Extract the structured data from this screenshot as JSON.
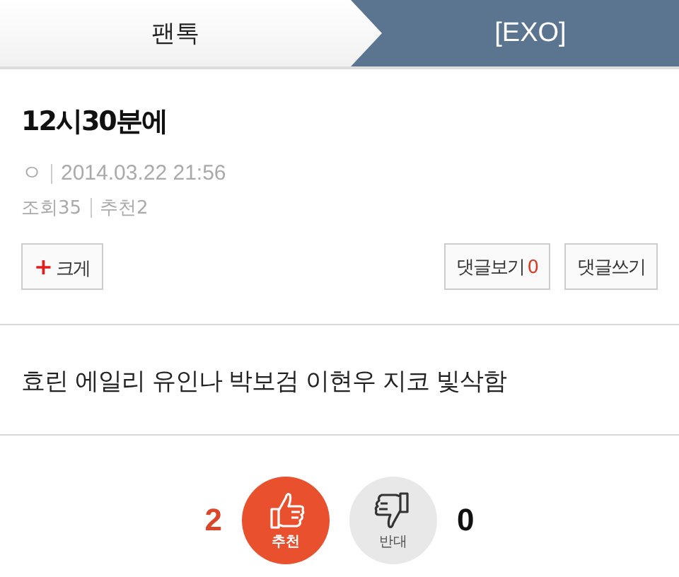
{
  "breadcrumb": [
    {
      "label": "팬톡",
      "kind": "parent"
    },
    {
      "label": "[EXO]",
      "kind": "current"
    }
  ],
  "post": {
    "title": "12시30분에",
    "author": "ㅇ",
    "date": "2014.03.22 21:56",
    "views": "조회35",
    "recommends": "추천2",
    "body": "효린 에일리 유인나 박보검 이현우 지코 빛삭함"
  },
  "buttons": {
    "enlarge": {
      "icon": "+",
      "label": "크게"
    },
    "view_comments": {
      "label": "댓글보기",
      "count": "0"
    },
    "write_comment": {
      "label": "댓글쓰기"
    }
  },
  "votes": {
    "up_count": "2",
    "up_label": "추천",
    "down_label": "반대",
    "down_count": "0"
  }
}
